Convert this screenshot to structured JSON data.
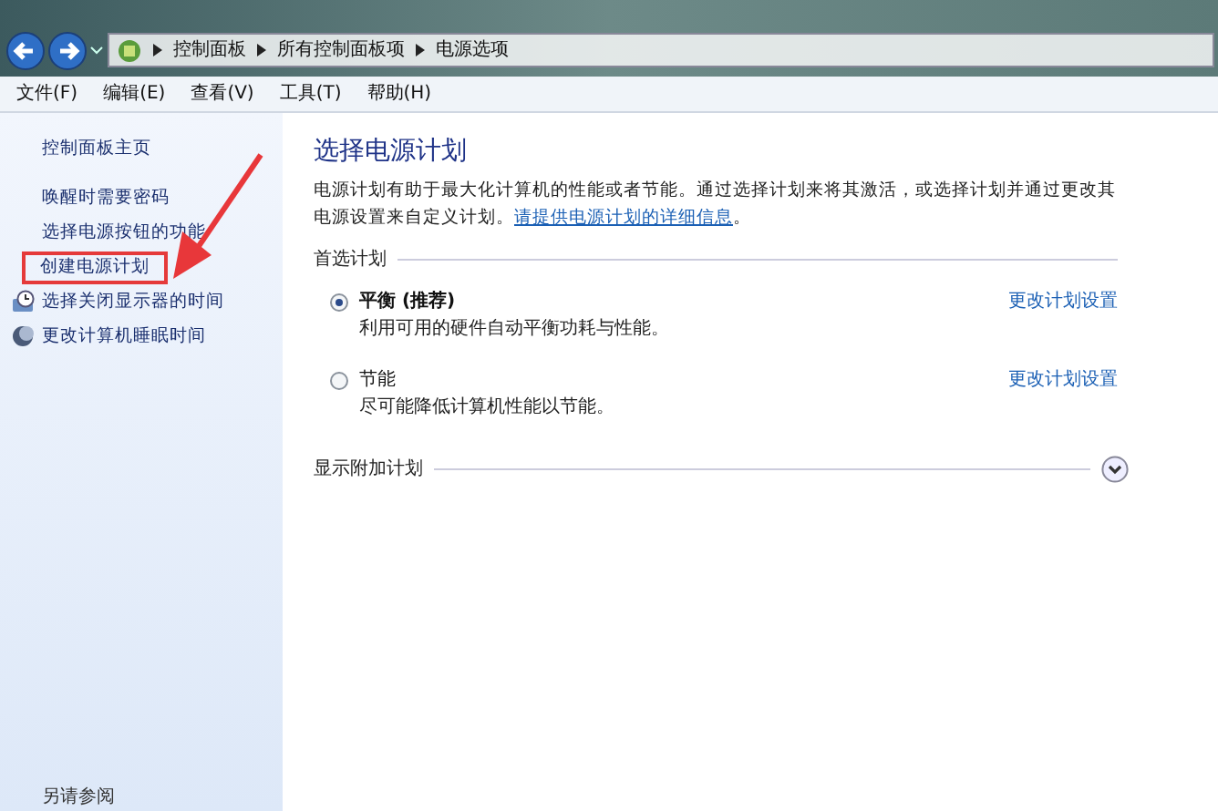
{
  "address_bar": {
    "breadcrumbs": [
      "控制面板",
      "所有控制面板项",
      "电源选项"
    ]
  },
  "menu_bar": [
    "文件(F)",
    "编辑(E)",
    "查看(V)",
    "工具(T)",
    "帮助(H)"
  ],
  "sidebar": {
    "items": [
      {
        "label": "控制面板主页",
        "kind": "home",
        "highlighted": false
      },
      {
        "label": "唤醒时需要密码",
        "kind": "link",
        "highlighted": false
      },
      {
        "label": "选择电源按钮的功能",
        "kind": "link",
        "highlighted": false
      },
      {
        "label": "创建电源计划",
        "kind": "link",
        "highlighted": true
      },
      {
        "label": "选择关闭显示器的时间",
        "kind": "monitor",
        "highlighted": false
      },
      {
        "label": "更改计算机睡眠时间",
        "kind": "moon",
        "highlighted": false
      }
    ],
    "see_also": "另请参阅"
  },
  "main": {
    "title": "选择电源计划",
    "description": "电源计划有助于最大化计算机的性能或者节能。通过选择计划来将其激活，或选择计划并通过更改其电源设置来自定义计划。",
    "description_link": "请提供电源计划的详细信息",
    "description_end": "。",
    "preferred_heading": "首选计划",
    "plans": [
      {
        "name": "平衡 (推荐)",
        "description": "利用可用的硬件自动平衡功耗与性能。",
        "selected": true,
        "link": "更改计划设置"
      },
      {
        "name": "节能",
        "description": "尽可能降低计算机性能以节能。",
        "selected": false,
        "link": "更改计划设置"
      }
    ],
    "additional_heading": "显示附加计划"
  }
}
